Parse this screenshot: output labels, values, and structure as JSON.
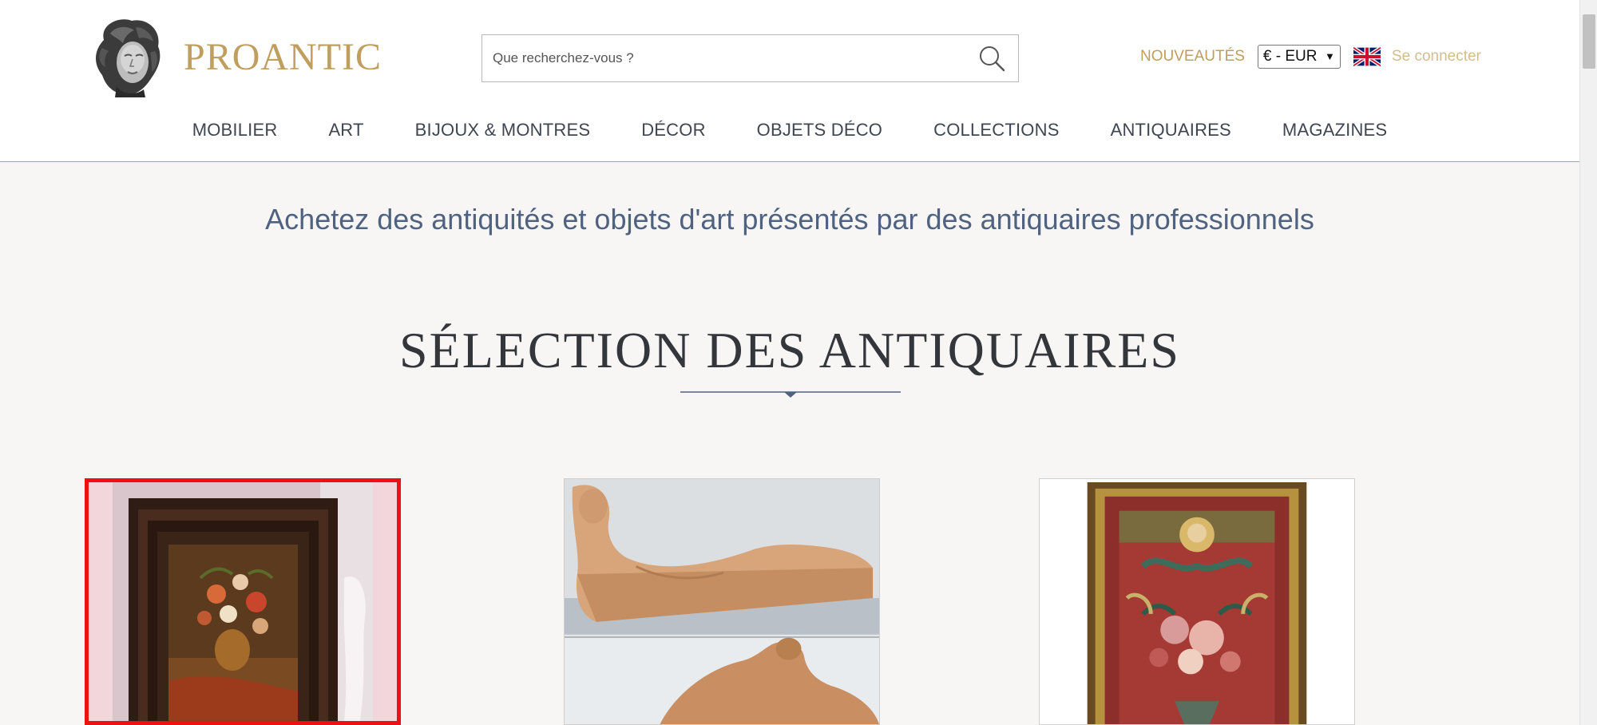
{
  "brand": {
    "name": "PROANTIC"
  },
  "search": {
    "placeholder": "Que recherchez-vous ?"
  },
  "header_links": {
    "new": "NOUVEAUTÉS",
    "currency": "€ - EUR",
    "login": "Se connecter"
  },
  "nav": [
    {
      "label": "MOBILIER"
    },
    {
      "label": "ART"
    },
    {
      "label": "BIJOUX & MONTRES"
    },
    {
      "label": "DÉCOR"
    },
    {
      "label": "OBJETS DÉCO"
    },
    {
      "label": "COLLECTIONS"
    },
    {
      "label": "ANTIQUAIRES"
    },
    {
      "label": "MAGAZINES"
    }
  ],
  "main": {
    "tagline": "Achetez des antiquités et objets d'art présentés par des antiquaires professionnels",
    "section_title": "SÉLECTION DES ANTIQUAIRES"
  },
  "colors": {
    "brand_gold": "#bf9e5e",
    "text_blue": "#4f6280",
    "selection_red": "#ee1111",
    "background": "#f7f6f4"
  },
  "icons": [
    "logo-bust-icon",
    "search-icon",
    "uk-flag-icon",
    "chevron-down-icon"
  ]
}
